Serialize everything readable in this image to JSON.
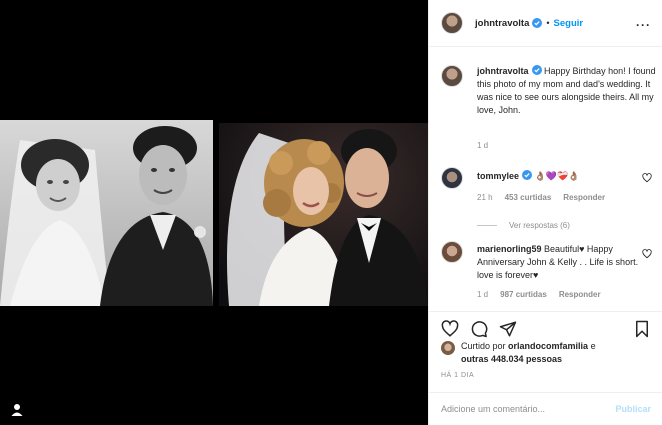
{
  "post": {
    "username": "johntravolta",
    "follow_label": "Seguir",
    "separator": "•",
    "more_label": "···"
  },
  "caption": {
    "username": "johntravolta",
    "text": "Happy Birthday hon! I found this photo of my mom and dad's wedding. It was nice to see ours alongside theirs. All my love, John.",
    "time": "1 d"
  },
  "comments": [
    {
      "username": "tommylee",
      "text": "👌🏽💜❤️‍🩹👌🏽",
      "time": "21 h",
      "likes": "453 curtidas",
      "reply_label": "Responder",
      "view_replies": "Ver respostas (6)"
    },
    {
      "username": "marienorling59",
      "text": "Beautiful♥ Happy Anniversary John & Kelly . . Life is short. love is forever♥",
      "time": "1 d",
      "likes": "987 curtidas",
      "reply_label": "Responder"
    }
  ],
  "likes_summary": {
    "prefix": "Curtido por",
    "user": "orlandocomfamilia",
    "and": "e",
    "others": "outras 448.034 pessoas"
  },
  "date_label": "HÁ 1 DIA",
  "add_comment": {
    "placeholder": "Adicione um comentário...",
    "post_label": "Publicar"
  },
  "colors": {
    "accent": "#0095f6",
    "muted": "#8e8e8e",
    "border": "#efefef",
    "post_disabled": "#b2dffc"
  },
  "icons": [
    "verified-badge-icon",
    "more-icon",
    "heart-icon",
    "comment-icon",
    "share-icon",
    "bookmark-icon",
    "tag-user-icon"
  ]
}
